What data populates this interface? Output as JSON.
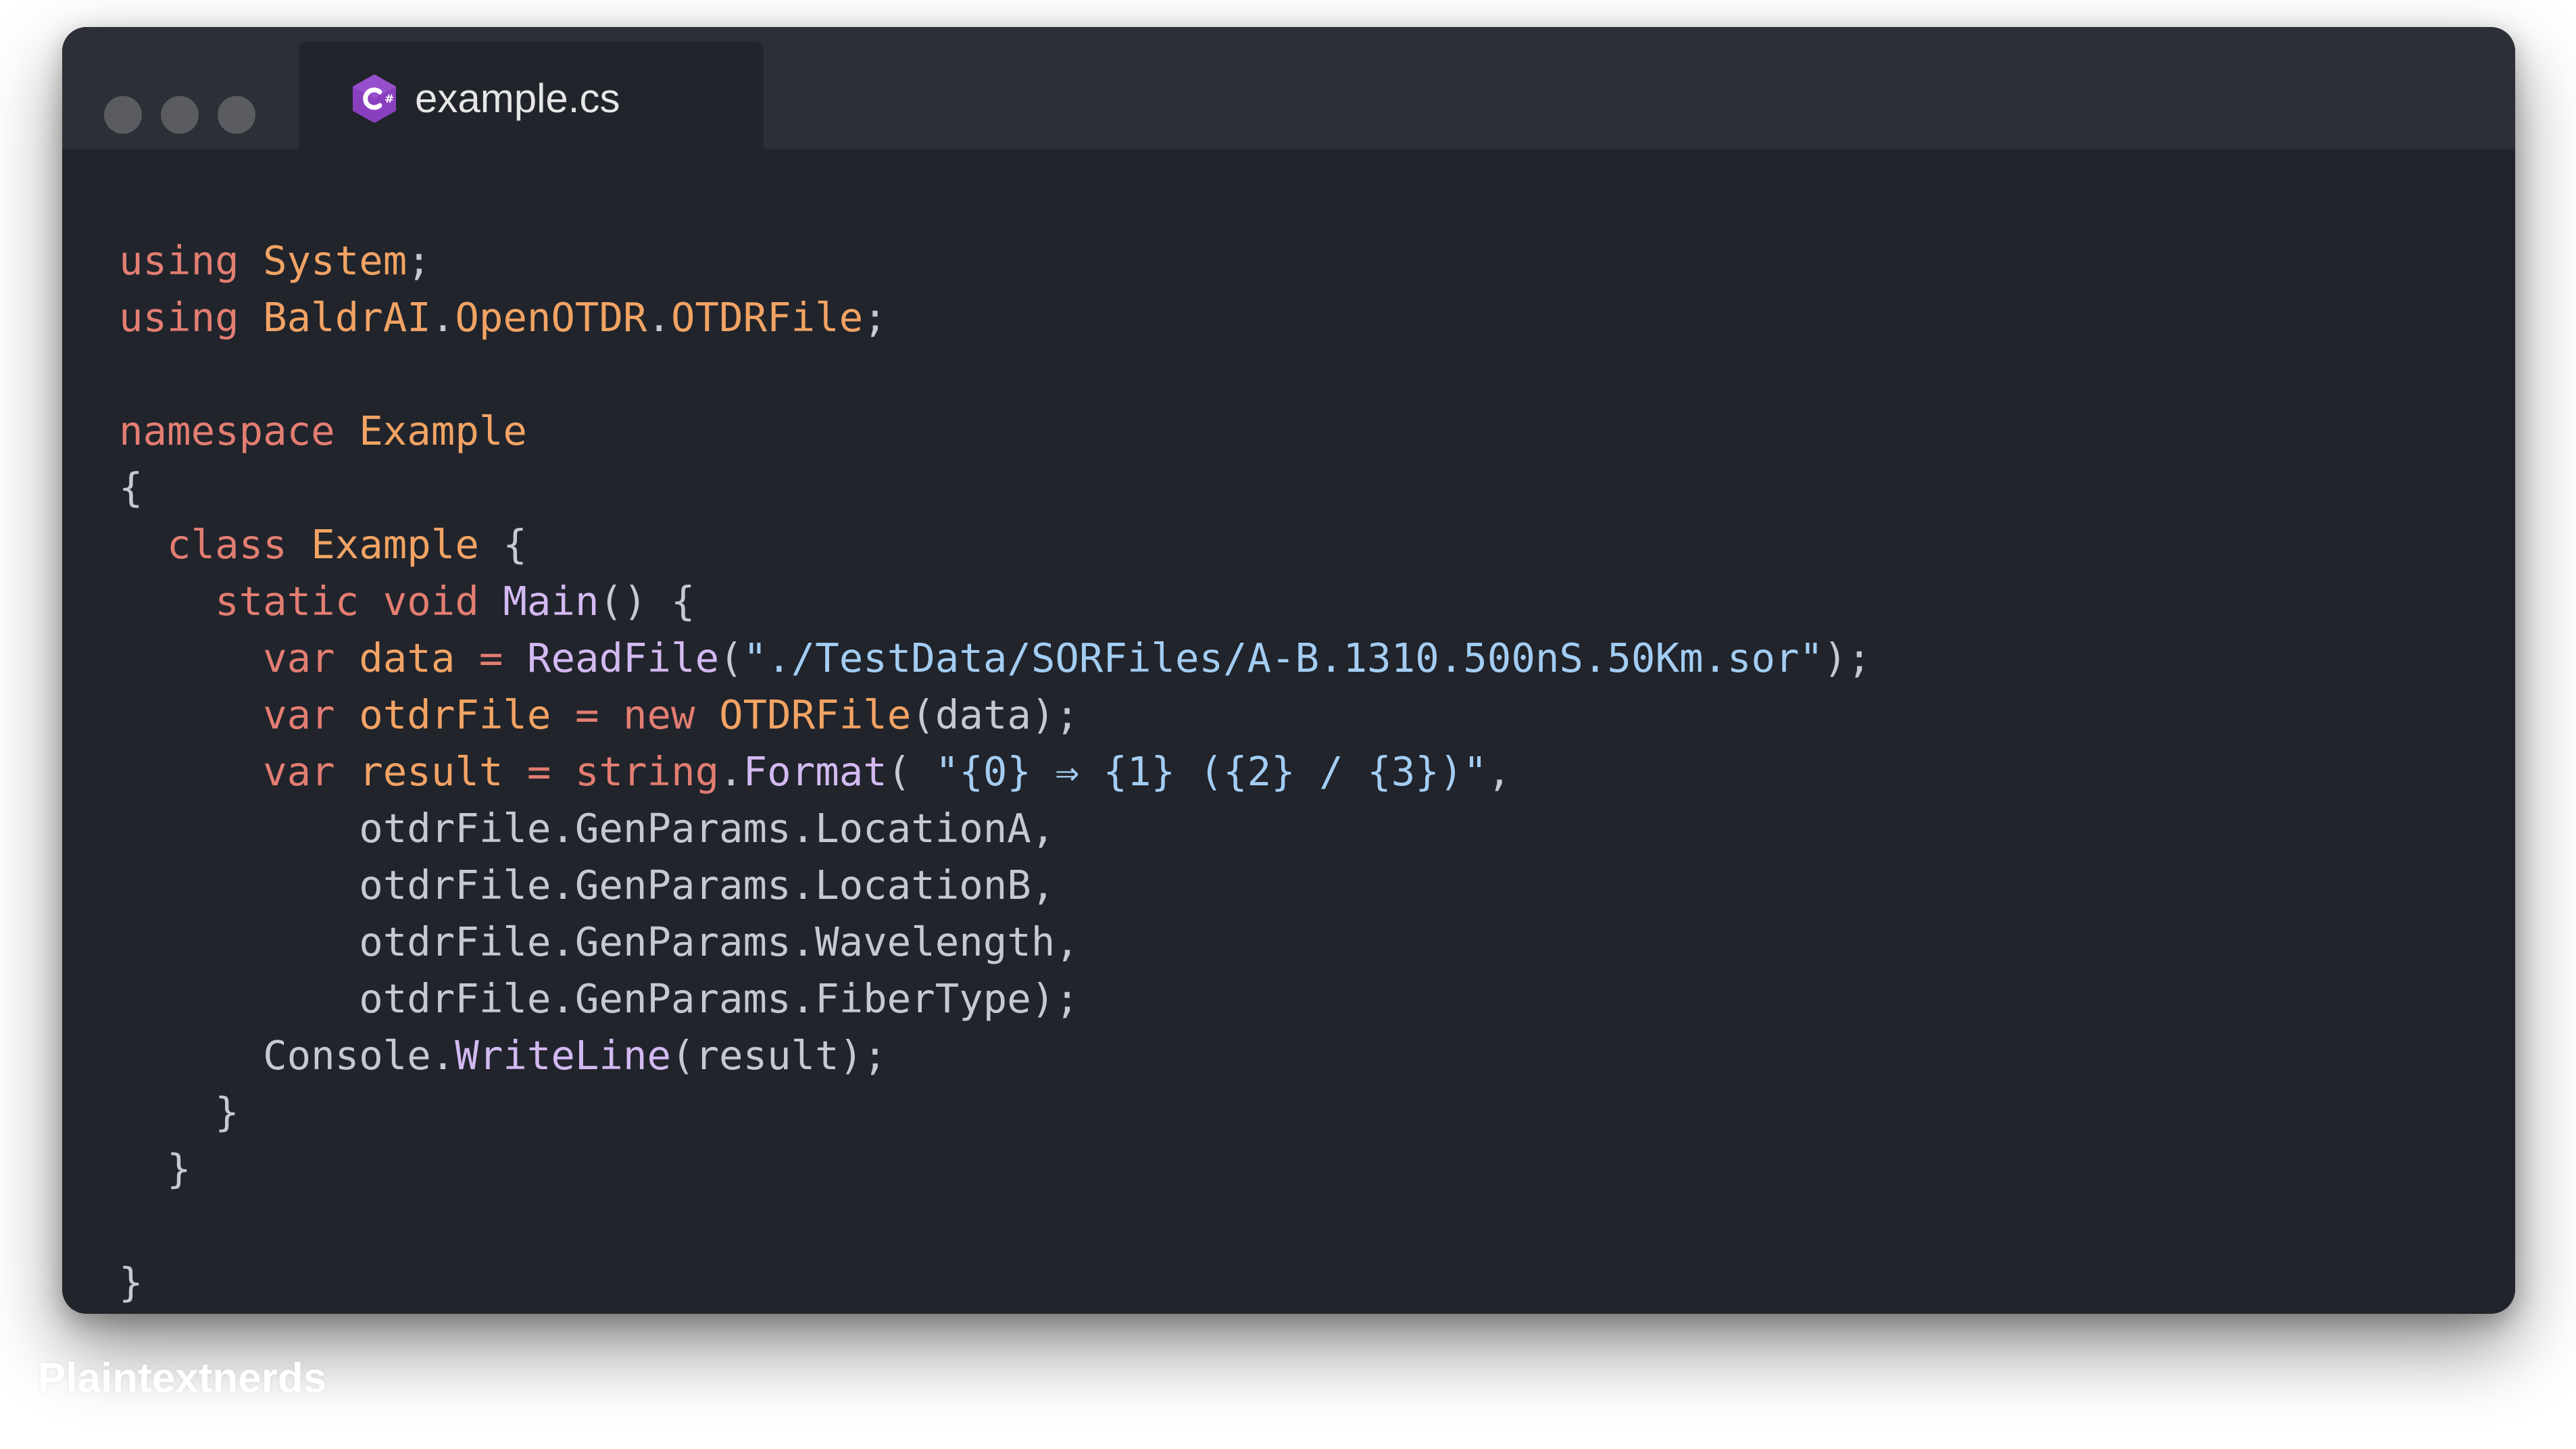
{
  "tab": {
    "filename": "example.cs",
    "icon": "csharp-icon"
  },
  "colors": {
    "keyword": "#e37d72",
    "type": "#f2a364",
    "identifier": "#c6c9cf",
    "function": "#d3b9f2",
    "string": "#a3cdf3",
    "background": "#21242b",
    "titlebar": "#2c2f36",
    "window_dot": "#5a5c62",
    "icon_purple": "#8a3fbf"
  },
  "code": {
    "language": "csharp",
    "lines": [
      [
        {
          "t": "kw",
          "v": "using"
        },
        {
          "t": "p",
          "v": " "
        },
        {
          "t": "type",
          "v": "System"
        },
        {
          "t": "p",
          "v": ";"
        }
      ],
      [
        {
          "t": "kw",
          "v": "using"
        },
        {
          "t": "p",
          "v": " "
        },
        {
          "t": "type",
          "v": "BaldrAI"
        },
        {
          "t": "p",
          "v": "."
        },
        {
          "t": "type",
          "v": "OpenOTDR"
        },
        {
          "t": "p",
          "v": "."
        },
        {
          "t": "type",
          "v": "OTDRFile"
        },
        {
          "t": "p",
          "v": ";"
        }
      ],
      [],
      [
        {
          "t": "kw",
          "v": "namespace"
        },
        {
          "t": "p",
          "v": " "
        },
        {
          "t": "type",
          "v": "Example"
        }
      ],
      [
        {
          "t": "p",
          "v": "{"
        }
      ],
      [
        {
          "t": "p",
          "v": "  "
        },
        {
          "t": "kw",
          "v": "class"
        },
        {
          "t": "p",
          "v": " "
        },
        {
          "t": "type",
          "v": "Example"
        },
        {
          "t": "p",
          "v": " {"
        }
      ],
      [
        {
          "t": "p",
          "v": "    "
        },
        {
          "t": "kw",
          "v": "static"
        },
        {
          "t": "p",
          "v": " "
        },
        {
          "t": "kw",
          "v": "void"
        },
        {
          "t": "p",
          "v": " "
        },
        {
          "t": "fn",
          "v": "Main"
        },
        {
          "t": "p",
          "v": "() {"
        }
      ],
      [
        {
          "t": "p",
          "v": "      "
        },
        {
          "t": "kw",
          "v": "var"
        },
        {
          "t": "p",
          "v": " "
        },
        {
          "t": "type",
          "v": "data"
        },
        {
          "t": "p",
          "v": " "
        },
        {
          "t": "op",
          "v": "="
        },
        {
          "t": "p",
          "v": " "
        },
        {
          "t": "fn",
          "v": "ReadFile"
        },
        {
          "t": "p",
          "v": "("
        },
        {
          "t": "str",
          "v": "\"./TestData/SORFiles/A-B.1310.500nS.50Km.sor\""
        },
        {
          "t": "p",
          "v": ");"
        }
      ],
      [
        {
          "t": "p",
          "v": "      "
        },
        {
          "t": "kw",
          "v": "var"
        },
        {
          "t": "p",
          "v": " "
        },
        {
          "t": "type",
          "v": "otdrFile"
        },
        {
          "t": "p",
          "v": " "
        },
        {
          "t": "op",
          "v": "="
        },
        {
          "t": "p",
          "v": " "
        },
        {
          "t": "kw",
          "v": "new"
        },
        {
          "t": "p",
          "v": " "
        },
        {
          "t": "type",
          "v": "OTDRFile"
        },
        {
          "t": "p",
          "v": "(data);"
        }
      ],
      [
        {
          "t": "p",
          "v": "      "
        },
        {
          "t": "kw",
          "v": "var"
        },
        {
          "t": "p",
          "v": " "
        },
        {
          "t": "type",
          "v": "result"
        },
        {
          "t": "p",
          "v": " "
        },
        {
          "t": "op",
          "v": "="
        },
        {
          "t": "p",
          "v": " "
        },
        {
          "t": "kw",
          "v": "string"
        },
        {
          "t": "p",
          "v": "."
        },
        {
          "t": "fn",
          "v": "Format"
        },
        {
          "t": "p",
          "v": "( "
        },
        {
          "t": "str",
          "v": "\"{0} ⇒ {1} ({2} / {3})\""
        },
        {
          "t": "p",
          "v": ","
        }
      ],
      [
        {
          "t": "p",
          "v": "          otdrFile.GenParams.LocationA,"
        }
      ],
      [
        {
          "t": "p",
          "v": "          otdrFile.GenParams.LocationB,"
        }
      ],
      [
        {
          "t": "p",
          "v": "          otdrFile.GenParams.Wavelength,"
        }
      ],
      [
        {
          "t": "p",
          "v": "          otdrFile.GenParams.FiberType);"
        }
      ],
      [
        {
          "t": "p",
          "v": "      Console."
        },
        {
          "t": "fn",
          "v": "WriteLine"
        },
        {
          "t": "p",
          "v": "(result);"
        }
      ],
      [
        {
          "t": "p",
          "v": "    }"
        }
      ],
      [
        {
          "t": "p",
          "v": "  }"
        }
      ],
      [],
      [
        {
          "t": "p",
          "v": "}"
        }
      ]
    ]
  },
  "watermark": "Plaintextnerds"
}
